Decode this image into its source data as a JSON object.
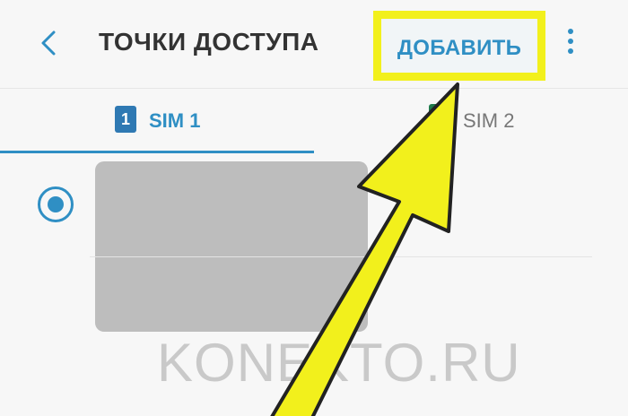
{
  "header": {
    "back_icon": "chevron-left-icon",
    "title": "ТОЧКИ ДОСТУПА",
    "add_label": "ДОБАВИТЬ",
    "menu_icon": "more-vertical-icon"
  },
  "tabs": [
    {
      "badge": "1",
      "label": "SIM 1",
      "selected": true
    },
    {
      "badge": "",
      "label": "SIM 2",
      "selected": false
    }
  ],
  "apn_list": {
    "radio_selected": true
  },
  "watermark": "KONEKTO.RU",
  "colors": {
    "accent": "#2f8fc4",
    "highlight": "#f2f01c",
    "sim1_badge": "#2f79b3",
    "sim2_badge": "#1f7a4b",
    "redacted": "#bdbdbd"
  }
}
